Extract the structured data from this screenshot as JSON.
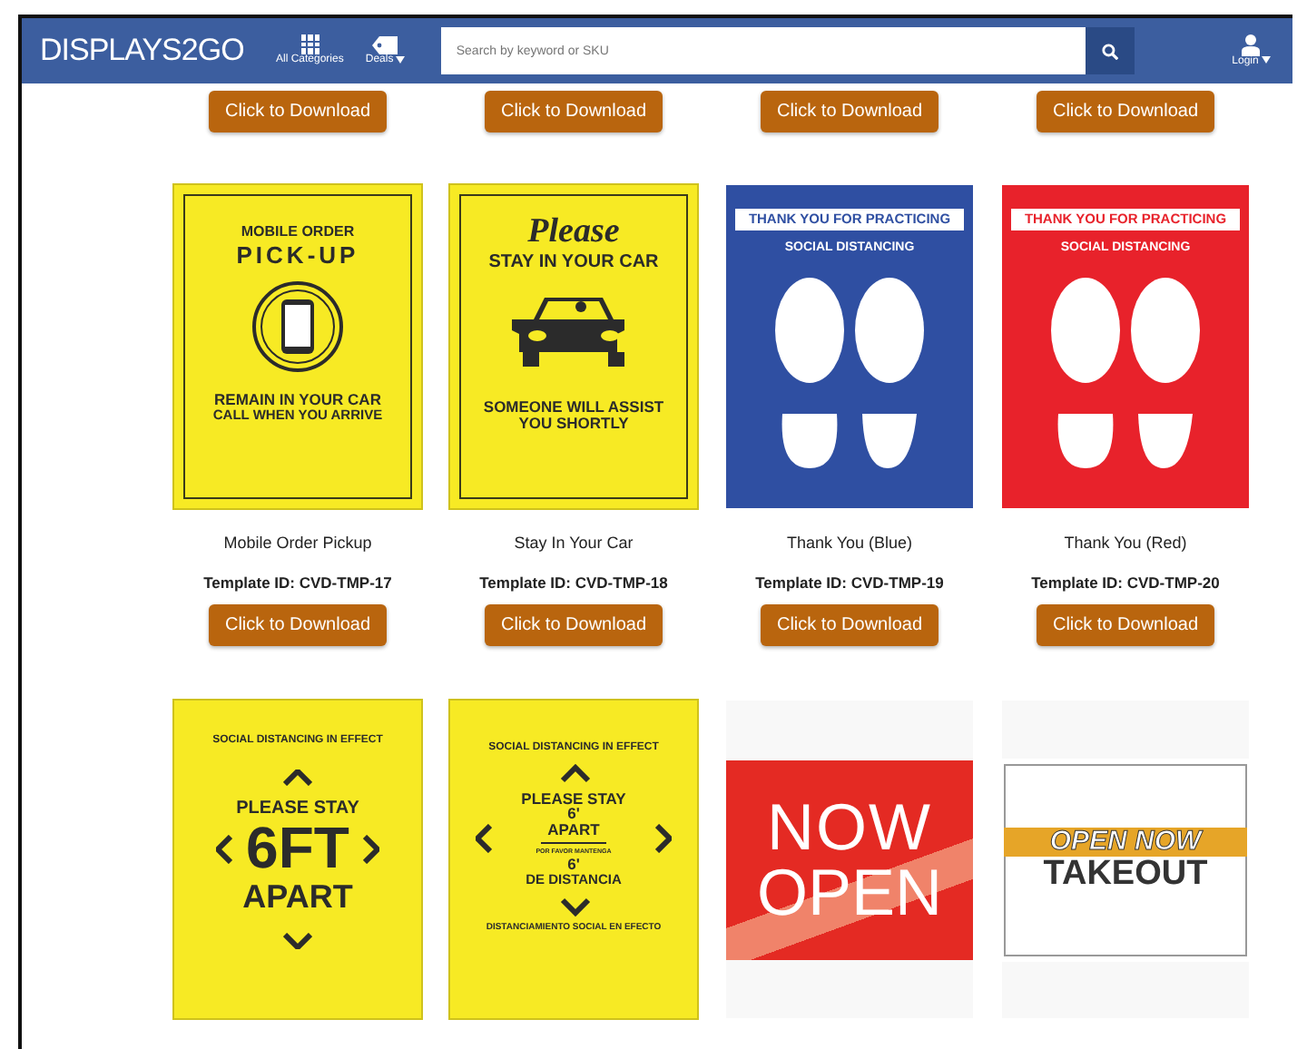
{
  "navbar": {
    "logo": "DISPLAYS2GO",
    "menus": [
      {
        "label": "All Categories",
        "kind": "categories",
        "dropdown": false
      },
      {
        "label": "Deals",
        "kind": "deals",
        "dropdown": true
      }
    ],
    "search": {
      "placeholder": "Search by keyword or SKU"
    },
    "account": {
      "label": "Login",
      "dropdown": true
    }
  },
  "top_buttons": [
    "Click to Download",
    "Click to Download",
    "Click to Download",
    "Click to Download"
  ],
  "products": [
    {
      "sign": {
        "kind": "pickup",
        "lines": [
          "MOBILE ORDER",
          "PICK-UP",
          "REMAIN IN YOUR CAR",
          "CALL WHEN YOU ARRIVE"
        ]
      },
      "title": "Mobile Order Pickup",
      "template_id": "Template ID: CVD-TMP-17",
      "button": "Click to Download"
    },
    {
      "sign": {
        "kind": "car",
        "lines": [
          "Please",
          "STAY IN YOUR CAR",
          "SOMEONE WILL ASSIST",
          "YOU SHORTLY"
        ]
      },
      "title": "Stay In Your Car",
      "template_id": "Template ID: CVD-TMP-18",
      "button": "Click to Download"
    },
    {
      "sign": {
        "kind": "footprints",
        "color": "#2f4fa2",
        "lines": [
          "THANK YOU FOR PRACTICING",
          "SOCIAL DISTANCING"
        ]
      },
      "title": "Thank You (Blue)",
      "template_id": "Template ID: CVD-TMP-19",
      "button": "Click to Download"
    },
    {
      "sign": {
        "kind": "footprints",
        "color": "#e8222b",
        "lines": [
          "THANK YOU FOR PRACTICING",
          "SOCIAL DISTANCING"
        ]
      },
      "title": "Thank You (Red)",
      "template_id": "Template ID: CVD-TMP-20",
      "button": "Click to Download"
    },
    {
      "sign": {
        "kind": "sixfeet",
        "lines": [
          "SOCIAL DISTANCING IN EFFECT",
          "PLEASE STAY",
          "6FT",
          "APART"
        ]
      }
    },
    {
      "sign": {
        "kind": "bilingual",
        "lines": [
          "SOCIAL DISTANCING IN EFFECT",
          "PLEASE STAY",
          "6'",
          "APART",
          "POR FAVOR MANTENGA",
          "6'",
          "DE DISTANCIA",
          "DISTANCIAMIENTO SOCIAL EN EFECTO"
        ]
      }
    },
    {
      "sign": {
        "kind": "nowopen",
        "lines": [
          "NOW",
          "OPEN"
        ]
      }
    },
    {
      "sign": {
        "kind": "takeout",
        "lines": [
          "OPEN NOW",
          "TAKEOUT"
        ]
      }
    }
  ]
}
